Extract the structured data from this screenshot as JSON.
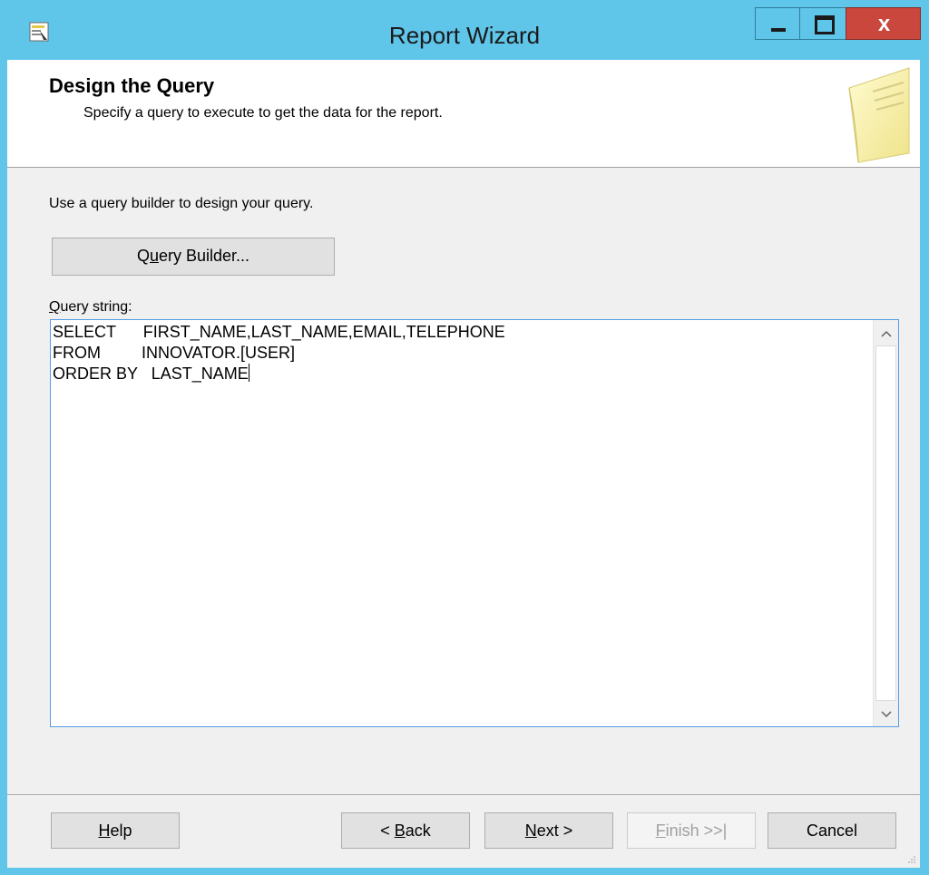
{
  "window": {
    "title": "Report Wizard",
    "close_glyph": "x"
  },
  "header": {
    "title": "Design the Query",
    "subtitle": "Specify a query to execute to get the data for the report."
  },
  "body": {
    "instruction": "Use a query builder to design your query.",
    "query_builder_prefix": "Q",
    "query_builder_mnemonic": "u",
    "query_builder_suffix": "ery Builder...",
    "query_label_mnemonic": "Q",
    "query_label_rest": "uery string:",
    "query_line1": "SELECT      FIRST_NAME,LAST_NAME,EMAIL,TELEPHONE",
    "query_line2": "FROM         INNOVATOR.[USER]",
    "query_line3": "ORDER BY   LAST_NAME"
  },
  "footer": {
    "help_mnemonic": "H",
    "help_rest": "elp",
    "back_prefix": "< ",
    "back_mnemonic": "B",
    "back_rest": "ack",
    "next_mnemonic": "N",
    "next_rest": "ext >",
    "finish_mnemonic": "F",
    "finish_rest": "inish >>|",
    "cancel_label": "Cancel"
  },
  "icons": {
    "app": "report-wizard-icon",
    "minimize": "minimize-icon",
    "maximize": "maximize-icon",
    "close": "close-icon",
    "scroll_up": "chevron-up-icon",
    "scroll_down": "chevron-down-icon",
    "header": "document-icon"
  }
}
